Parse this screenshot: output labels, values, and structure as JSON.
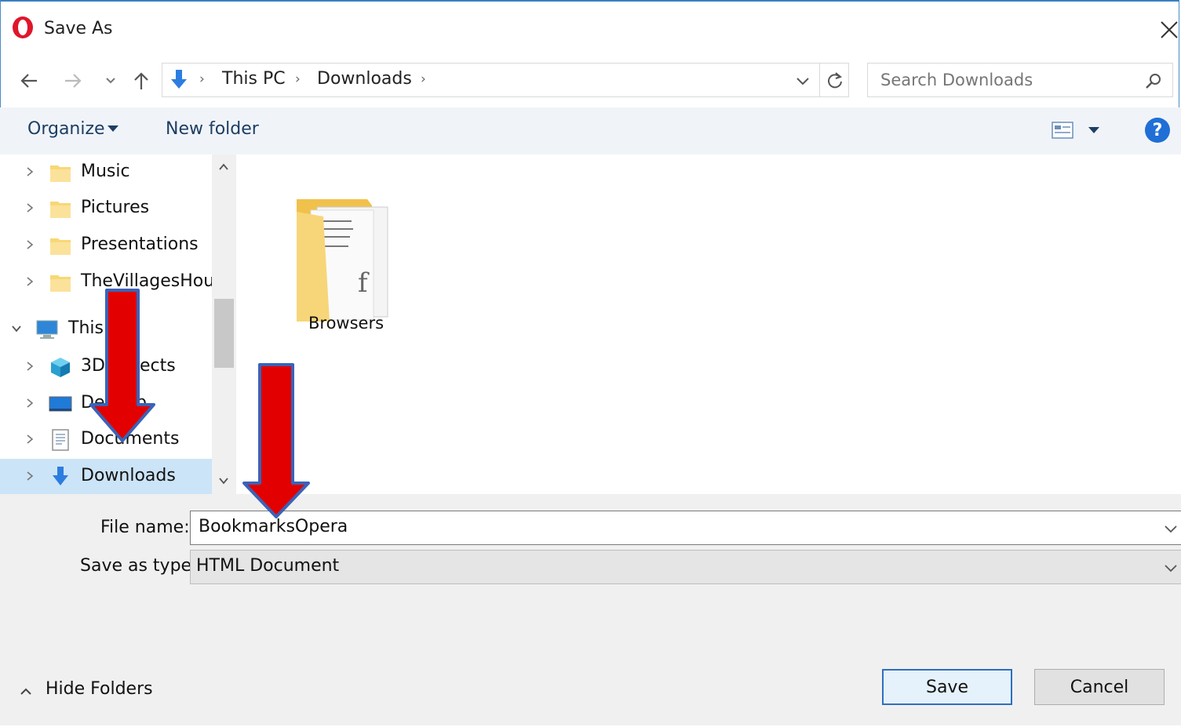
{
  "window": {
    "title": "Save As",
    "app_icon": "opera-logo-icon",
    "close_icon": "close-icon"
  },
  "nav": {
    "back_icon": "back-arrow-icon",
    "forward_icon": "forward-arrow-icon",
    "recent_icon": "chevron-down-icon",
    "up_icon": "up-arrow-icon",
    "breadcrumbs": [
      "This PC",
      "Downloads"
    ],
    "refresh_icon": "refresh-icon",
    "search_placeholder": "Search Downloads"
  },
  "toolbar": {
    "organize_label": "Organize",
    "new_folder_label": "New folder",
    "help_label": "?"
  },
  "tree": {
    "items": [
      {
        "label": "Music",
        "icon": "folder-icon"
      },
      {
        "label": "Pictures",
        "icon": "folder-icon"
      },
      {
        "label": "Presentations",
        "icon": "folder-icon"
      },
      {
        "label": "TheVillagesHous",
        "icon": "folder-icon"
      },
      {
        "label": "This",
        "icon": "computer-icon"
      },
      {
        "label": "3D",
        "label_suffix": "ects",
        "icon": "3d-objects-icon"
      },
      {
        "label": "De",
        "label_suffix": "p",
        "icon": "desktop-icon"
      },
      {
        "label": "Documents",
        "icon": "documents-icon"
      },
      {
        "label": "Downloads",
        "icon": "downloads-icon",
        "selected": true
      }
    ]
  },
  "content": {
    "items": [
      {
        "label": "Browsers",
        "icon": "folder-with-documents-icon"
      }
    ]
  },
  "form": {
    "file_name_label": "File name:",
    "file_name_value": "BookmarksOpera",
    "save_type_label": "Save as type:",
    "save_type_value": "HTML Document"
  },
  "footer": {
    "hide_folders_label": "Hide Folders",
    "save_label": "Save",
    "cancel_label": "Cancel"
  },
  "colors": {
    "accent": "#1f6fd6",
    "annotation_arrow": "#e30000",
    "selection": "#cce4f7",
    "toolbar_bg": "#f0f4f9",
    "bottom_bg": "#f0f0f0"
  }
}
